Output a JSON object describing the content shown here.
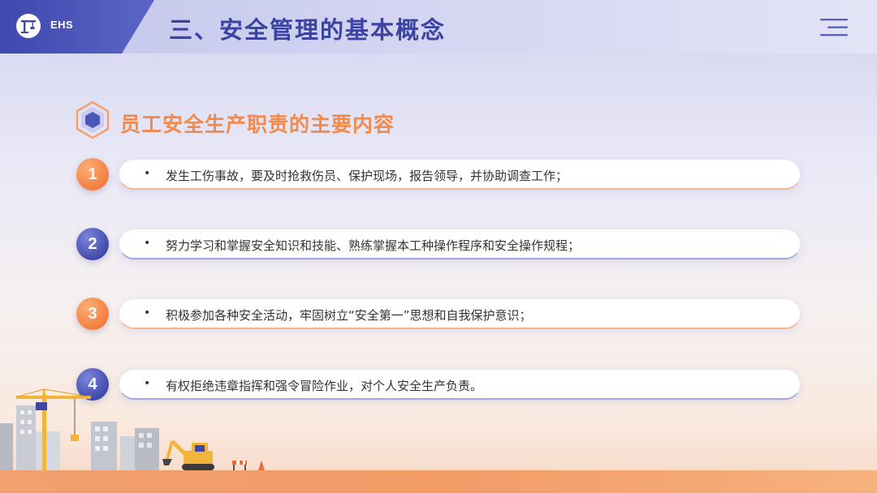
{
  "header": {
    "brand": "EHS",
    "title": "三、安全管理的基本概念",
    "logo_icon": "crane-logo-icon",
    "menu_icon": "menu-lines-icon"
  },
  "section": {
    "title": "员工安全生产职责的主要内容",
    "icon": "hexagon-icon"
  },
  "items": [
    {
      "number": "1",
      "bullet": "•",
      "text": "发生工伤事故，要及时抢救伤员、保护现场，报告领导，并协助调查工作；"
    },
    {
      "number": "2",
      "bullet": "•",
      "text": "努力学习和掌握安全知识和技能、熟练掌握本工种操作程序和安全操作规程；"
    },
    {
      "number": "3",
      "bullet": "•",
      "text": "积极参加各种安全活动，牢固树立“安全第一”思想和自我保护意识；"
    },
    {
      "number": "4",
      "bullet": "•",
      "text": "有权拒绝违章指挥和强令冒险作业，对个人安全生产负责。"
    }
  ],
  "colors": {
    "primary_blue": "#3e47a8",
    "accent_orange": "#f08a4d",
    "title_blue": "#3b44a0"
  },
  "illustration": {
    "icons": [
      "tower-crane-icon",
      "buildings-icon",
      "excavator-icon",
      "road-barrier-icon"
    ]
  }
}
